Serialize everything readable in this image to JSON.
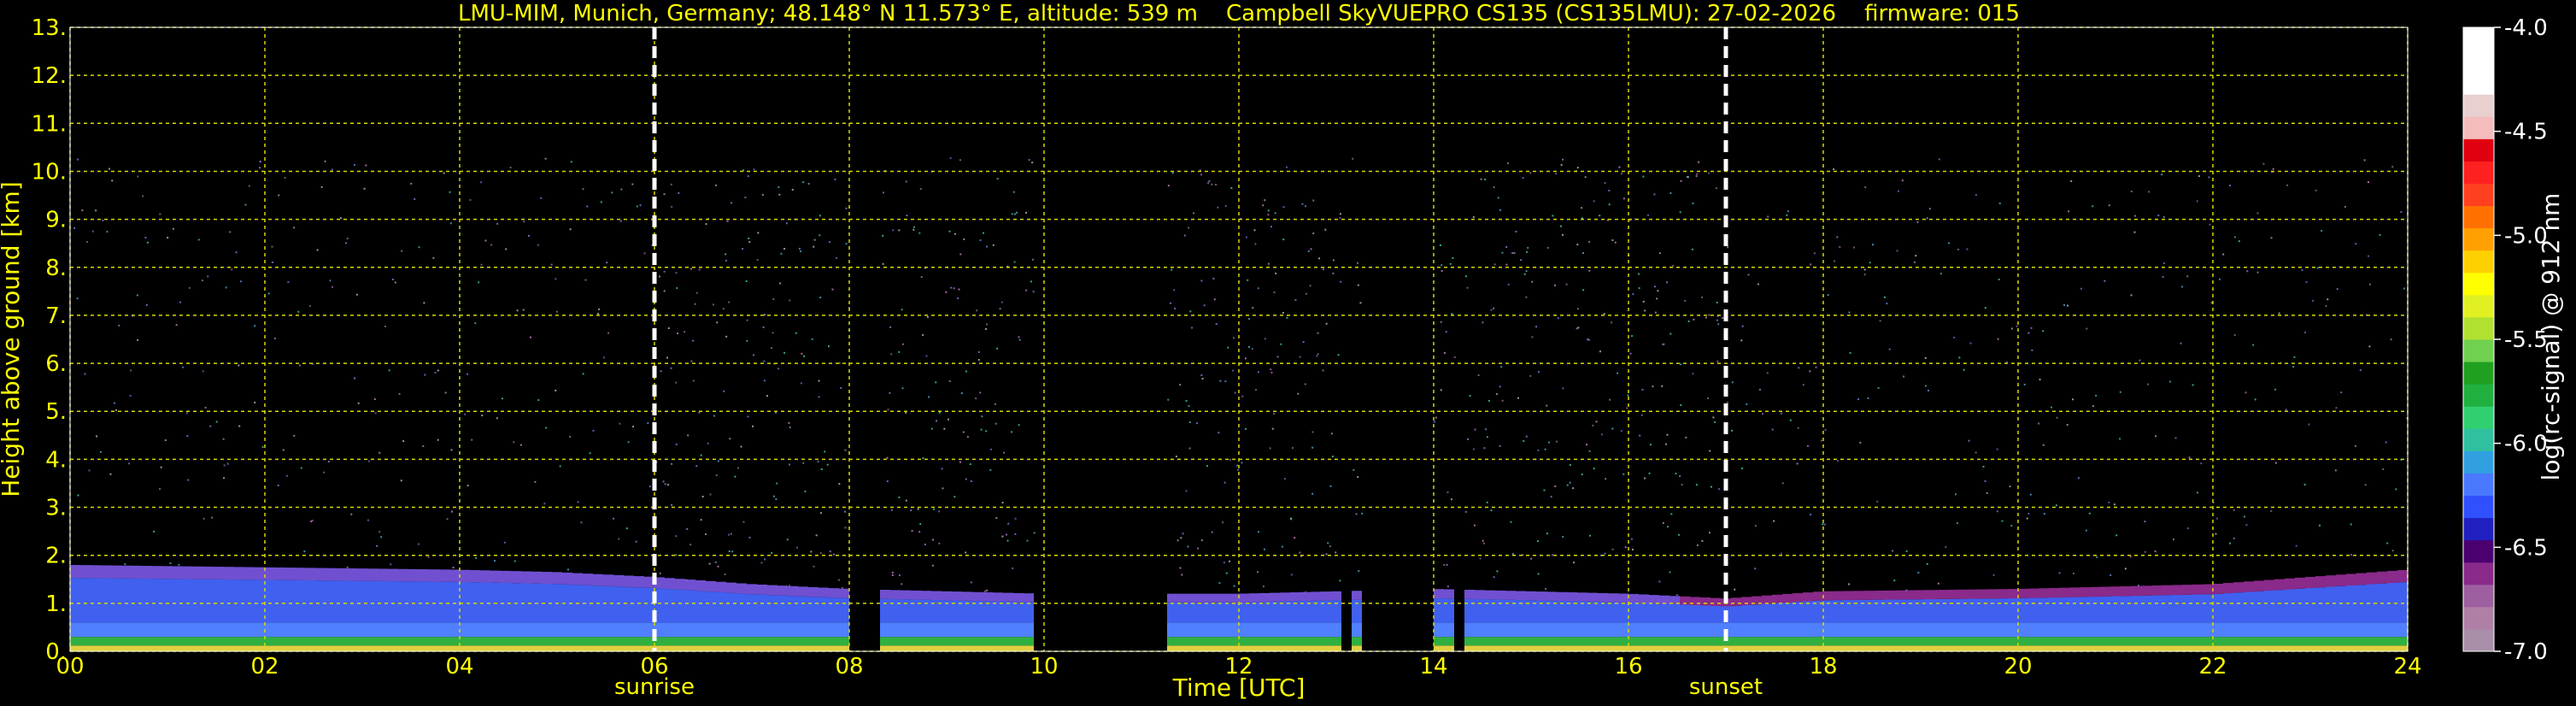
{
  "chart_data": {
    "type": "heatmap",
    "title": "LMU-MIM, Munich, Germany; 48.148° N 11.573° E, altitude: 539 m    Campbell SkyVUEPRO CS135 (CS135LMU): 27-02-2026    firmware: 015",
    "xlabel": "Time [UTC]",
    "ylabel": "Height above ground [km]",
    "xlim": [
      0,
      24
    ],
    "ylim": [
      0,
      13
    ],
    "x_ticks": [
      "00",
      "02",
      "04",
      "06",
      "08",
      "10",
      "12",
      "14",
      "16",
      "18",
      "20",
      "22",
      "24"
    ],
    "y_ticks": [
      "0.",
      "1.",
      "2.",
      "3.",
      "4.",
      "5.",
      "6.",
      "7.",
      "8.",
      "9.",
      "10.",
      "11.",
      "12.",
      "13."
    ],
    "grid": true,
    "markers": [
      {
        "label": "sunrise",
        "x": 6.0
      },
      {
        "label": "sunset",
        "x": 17.0
      }
    ],
    "data_top_km": 10.3,
    "colorbar": {
      "label": "log(rc-signal) @ 912 nm",
      "range": [
        -7.0,
        -4.0
      ],
      "ticks": [
        "-4.0",
        "-4.5",
        "-5.0",
        "-5.5",
        "-6.0",
        "-6.5",
        "-7.0"
      ],
      "colors": [
        "#a98fa9",
        "#b07fa6",
        "#9e5fa0",
        "#8a2a8a",
        "#4b0070",
        "#2020c0",
        "#3050ff",
        "#4a78ff",
        "#30a0e0",
        "#30c0a0",
        "#30d070",
        "#20b040",
        "#20a020",
        "#70d050",
        "#b0e030",
        "#e0f020",
        "#ffff00",
        "#ffd000",
        "#ffa000",
        "#ff7000",
        "#ff4020",
        "#ff2020",
        "#e00010",
        "#f4bcbc",
        "#e8d0d0",
        "#ffffff",
        "#ffffff",
        "#ffffff"
      ]
    },
    "data_gaps_hours": [
      [
        8.05,
        8.3
      ],
      [
        8.42,
        8.45
      ],
      [
        9.85,
        11.3
      ],
      [
        13.05,
        13.15
      ],
      [
        13.3,
        14.05
      ],
      [
        14.2,
        14.35
      ]
    ],
    "layers": [
      {
        "name": "boundary layer top",
        "x": [
          0,
          2,
          4,
          5,
          6,
          7,
          8,
          10,
          12,
          14,
          16,
          17,
          18,
          20,
          22,
          24
        ],
        "y": [
          1.8,
          1.75,
          1.7,
          1.65,
          1.55,
          1.4,
          1.3,
          1.2,
          1.2,
          1.3,
          1.2,
          1.1,
          1.25,
          1.3,
          1.4,
          1.7
        ]
      }
    ]
  }
}
